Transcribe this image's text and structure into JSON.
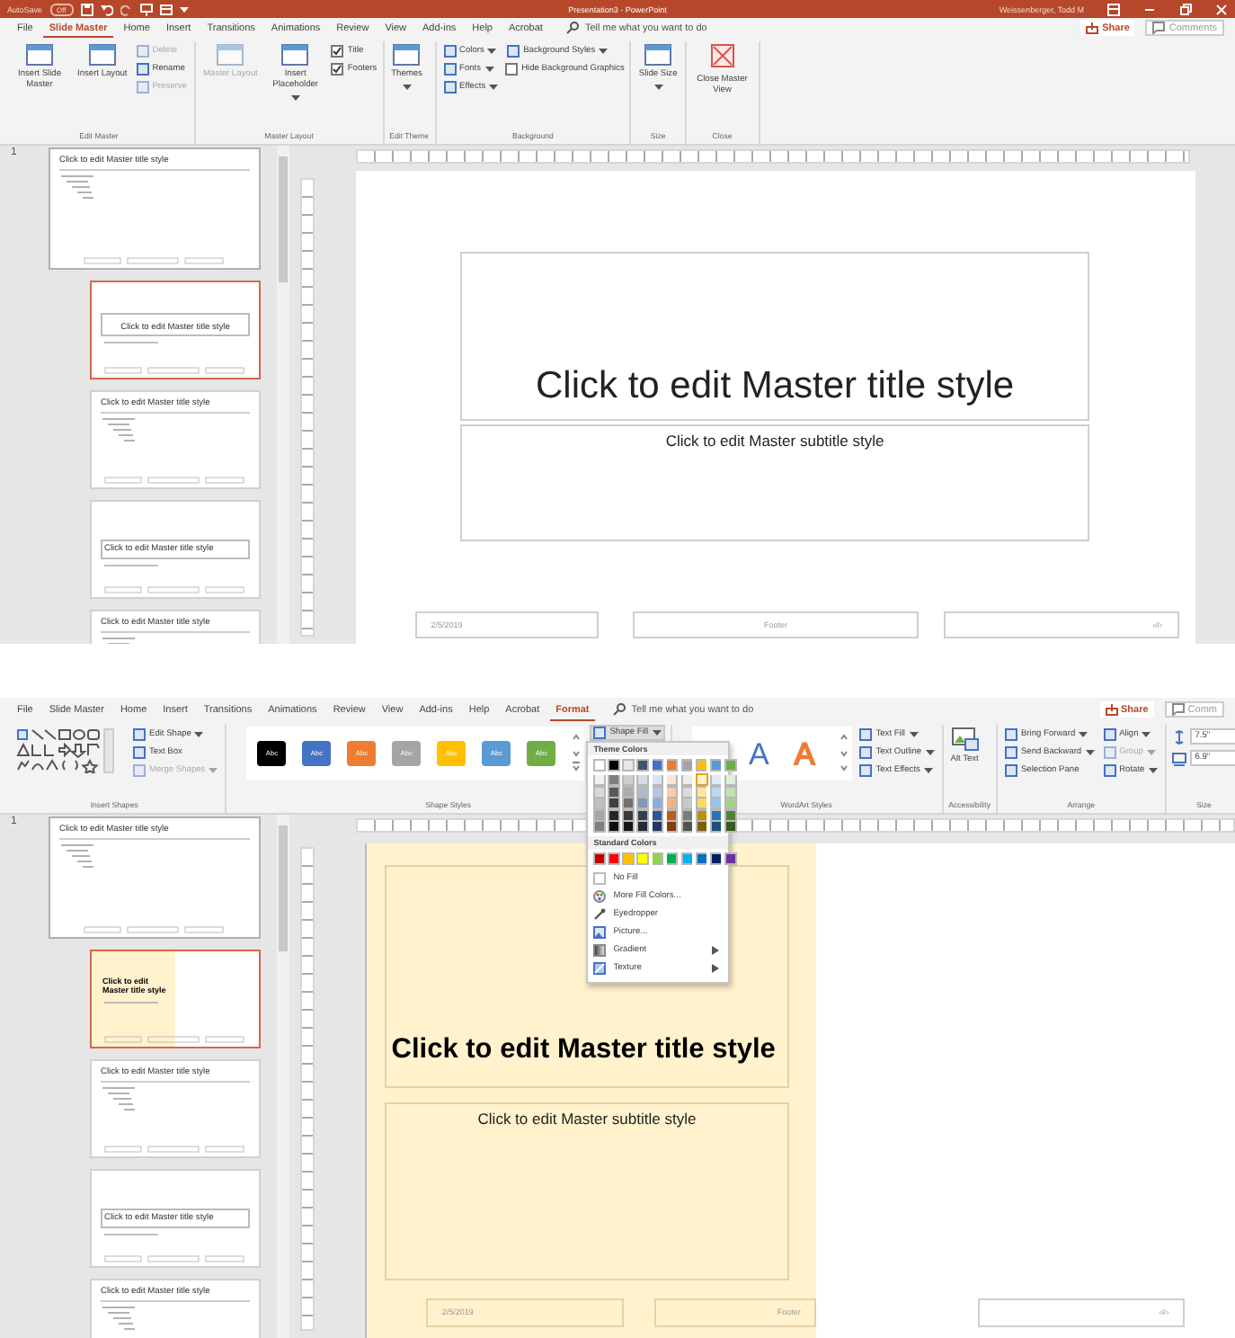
{
  "screens": [
    {
      "title_bar": {
        "autosave": "AutoSave",
        "autosave_state": "Off",
        "title": "Presentation3  -  PowerPoint",
        "user": "Weissenberger, Todd M"
      },
      "tabs": [
        {
          "label": "File",
          "selected": false
        },
        {
          "label": "Slide Master",
          "selected": true
        },
        {
          "label": "Home",
          "selected": false
        },
        {
          "label": "Insert",
          "selected": false
        },
        {
          "label": "Transitions",
          "selected": false
        },
        {
          "label": "Animations",
          "selected": false
        },
        {
          "label": "Review",
          "selected": false
        },
        {
          "label": "View",
          "selected": false
        },
        {
          "label": "Add-ins",
          "selected": false
        },
        {
          "label": "Help",
          "selected": false
        },
        {
          "label": "Acrobat",
          "selected": false
        }
      ],
      "tell_me": "Tell me what you want to do",
      "share": "Share",
      "comments": "Comments",
      "ribbon": [
        {
          "label": "Edit Master",
          "columns": [
            [
              {
                "kind": "large",
                "label": "Insert Slide Master",
                "dropdown": false,
                "disabled": false
              }
            ],
            [
              {
                "kind": "large",
                "label": "Insert Layout",
                "dropdown": false,
                "disabled": false
              }
            ],
            [
              {
                "kind": "small",
                "label": "Delete",
                "dropdown": false,
                "disabled": true
              },
              {
                "kind": "small",
                "label": "Rename",
                "dropdown": false,
                "disabled": false
              },
              {
                "kind": "small",
                "label": "Preserve",
                "dropdown": false,
                "disabled": true
              }
            ]
          ]
        },
        {
          "label": "Master Layout",
          "columns": [
            [
              {
                "kind": "large",
                "label": "Master Layout",
                "dropdown": false,
                "disabled": true
              }
            ],
            [
              {
                "kind": "large",
                "label": "Insert Placeholder",
                "dropdown": true,
                "disabled": false
              }
            ],
            [
              {
                "kind": "check",
                "label": "Title",
                "checked": true
              },
              {
                "kind": "check",
                "label": "Footers",
                "checked": true
              }
            ]
          ]
        },
        {
          "label": "Edit Theme",
          "columns": [
            [
              {
                "kind": "large",
                "label": "Themes",
                "dropdown": true,
                "disabled": false
              }
            ]
          ]
        },
        {
          "label": "Background",
          "columns": [
            [
              {
                "kind": "small",
                "label": "Colors",
                "dropdown": true,
                "disabled": false
              },
              {
                "kind": "small",
                "label": "Fonts",
                "dropdown": true,
                "disabled": false
              },
              {
                "kind": "small",
                "label": "Effects",
                "dropdown": true,
                "disabled": false
              }
            ],
            [
              {
                "kind": "small",
                "label": "Background Styles",
                "dropdown": true,
                "disabled": false
              },
              {
                "kind": "check",
                "label": "Hide Background Graphics",
                "checked": false
              }
            ]
          ]
        },
        {
          "label": "Size",
          "columns": [
            [
              {
                "kind": "large",
                "label": "Slide Size",
                "dropdown": true,
                "disabled": false
              }
            ]
          ]
        },
        {
          "label": "Close",
          "columns": [
            [
              {
                "kind": "large",
                "label": "Close Master View",
                "dropdown": false,
                "disabled": false
              }
            ]
          ]
        }
      ],
      "thumbnails": [
        {
          "number": "1",
          "kind": "master",
          "title": "Click to edit Master title style",
          "selected": false,
          "filled": false
        },
        {
          "kind": "title",
          "title": "Click to edit Master title style",
          "selected": true,
          "filled": false
        },
        {
          "kind": "content",
          "title": "Click to edit Master title style",
          "selected": false,
          "filled": false
        },
        {
          "kind": "section",
          "title": "Click to edit Master title style",
          "selected": false,
          "filled": false
        },
        {
          "kind": "content",
          "title": "Click to edit Master title style",
          "selected": false,
          "filled": false
        }
      ],
      "slide": {
        "filled": false,
        "title": "Click to edit Master title style",
        "subtitle": "Click to edit Master subtitle style",
        "date": "2/5/2019",
        "footer": "Footer",
        "number": "‹#›"
      }
    },
    {
      "tabs": [
        {
          "label": "File",
          "selected": false
        },
        {
          "label": "Slide Master",
          "selected": false
        },
        {
          "label": "Home",
          "selected": false
        },
        {
          "label": "Insert",
          "selected": false
        },
        {
          "label": "Transitions",
          "selected": false
        },
        {
          "label": "Animations",
          "selected": false
        },
        {
          "label": "Review",
          "selected": false
        },
        {
          "label": "View",
          "selected": false
        },
        {
          "label": "Add-ins",
          "selected": false
        },
        {
          "label": "Help",
          "selected": false
        },
        {
          "label": "Acrobat",
          "selected": false
        },
        {
          "label": "Format",
          "selected": true
        }
      ],
      "tell_me": "Tell me what you want to do",
      "share": "Share",
      "comments": "Comm",
      "ribbon": [
        {
          "label": "Insert Shapes",
          "columns": [
            [
              {
                "kind": "shapes"
              }
            ],
            [
              {
                "kind": "small",
                "label": "Edit Shape",
                "dropdown": true,
                "disabled": false
              },
              {
                "kind": "small",
                "label": "Text Box",
                "dropdown": false,
                "disabled": false
              },
              {
                "kind": "small",
                "label": "Merge Shapes",
                "dropdown": true,
                "disabled": true
              }
            ]
          ]
        },
        {
          "label": "Shape Styles",
          "columns": [
            [
              {
                "kind": "styles",
                "swatches": [
                  {
                    "label": "Abc",
                    "color": "#000000"
                  },
                  {
                    "label": "Abc",
                    "color": "#4472c4"
                  },
                  {
                    "label": "Abc",
                    "color": "#ed7d31"
                  },
                  {
                    "label": "Abc",
                    "color": "#a5a5a5"
                  },
                  {
                    "label": "Abc",
                    "color": "#ffc000"
                  },
                  {
                    "label": "Abc",
                    "color": "#5b9bd5"
                  },
                  {
                    "label": "Abc",
                    "color": "#70ad47"
                  }
                ]
              }
            ],
            [
              {
                "kind": "small",
                "label": "Shape Fill",
                "dropdown": true,
                "disabled": false
              }
            ]
          ]
        },
        {
          "label": "WordArt Styles",
          "columns": [
            [
              {
                "kind": "wordart",
                "letters": [
                  {
                    "label": "A",
                    "kind": "fill",
                    "color": "#4472c4"
                  },
                  {
                    "label": "A",
                    "kind": "outline",
                    "color": "#ed7d31"
                  }
                ]
              }
            ],
            [
              {
                "kind": "small",
                "label": "Text Fill",
                "dropdown": true,
                "disabled": false
              },
              {
                "kind": "small",
                "label": "Text Outline",
                "dropdown": true,
                "disabled": false
              },
              {
                "kind": "small",
                "label": "Text Effects",
                "dropdown": true,
                "disabled": false
              }
            ]
          ]
        },
        {
          "label": "Accessibility",
          "columns": [
            [
              {
                "kind": "large",
                "label": "Alt Text",
                "dropdown": false,
                "disabled": false
              }
            ]
          ]
        },
        {
          "label": "Arrange",
          "columns": [
            [
              {
                "kind": "small",
                "label": "Bring Forward",
                "dropdown": true,
                "disabled": false
              },
              {
                "kind": "small",
                "label": "Send Backward",
                "dropdown": true,
                "disabled": false
              },
              {
                "kind": "small",
                "label": "Selection Pane",
                "dropdown": false,
                "disabled": false
              }
            ],
            [
              {
                "kind": "small",
                "label": "Align",
                "dropdown": true,
                "disabled": false
              },
              {
                "kind": "small",
                "label": "Group",
                "dropdown": true,
                "disabled": true
              },
              {
                "kind": "small",
                "label": "Rotate",
                "dropdown": true,
                "disabled": false
              }
            ]
          ]
        },
        {
          "label": "Size",
          "columns": [
            [
              {
                "kind": "spin",
                "value": "7.5\""
              },
              {
                "kind": "spin",
                "value": "6.9\""
              }
            ]
          ]
        }
      ],
      "shape_fill_menu": {
        "theme_heading": "Theme Colors",
        "theme_colors": [
          {
            "color": "#ffffff",
            "selected": false,
            "shades": [
              {
                "color": "#f2f2f2",
                "selected": false
              },
              {
                "color": "#d9d9d9",
                "selected": false
              },
              {
                "color": "#bfbfbf",
                "selected": false
              },
              {
                "color": "#a6a6a6",
                "selected": false
              },
              {
                "color": "#7f7f7f",
                "selected": false
              }
            ]
          },
          {
            "color": "#000000",
            "selected": false,
            "shades": [
              {
                "color": "#7f7f7f",
                "selected": false
              },
              {
                "color": "#595959",
                "selected": false
              },
              {
                "color": "#3f3f3f",
                "selected": false
              },
              {
                "color": "#262626",
                "selected": false
              },
              {
                "color": "#0d0d0d",
                "selected": false
              }
            ]
          },
          {
            "color": "#e7e6e6",
            "selected": false,
            "shades": [
              {
                "color": "#d0cece",
                "selected": false
              },
              {
                "color": "#aeabab",
                "selected": false
              },
              {
                "color": "#757070",
                "selected": false
              },
              {
                "color": "#3a3838",
                "selected": false
              },
              {
                "color": "#171616",
                "selected": false
              }
            ]
          },
          {
            "color": "#44546a",
            "selected": false,
            "shades": [
              {
                "color": "#d6dce4",
                "selected": false
              },
              {
                "color": "#adb9ca",
                "selected": false
              },
              {
                "color": "#8496b0",
                "selected": false
              },
              {
                "color": "#333f4f",
                "selected": false
              },
              {
                "color": "#222a35",
                "selected": false
              }
            ]
          },
          {
            "color": "#4472c4",
            "selected": false,
            "shades": [
              {
                "color": "#dae3f3",
                "selected": false
              },
              {
                "color": "#b4c7e7",
                "selected": false
              },
              {
                "color": "#8faadc",
                "selected": false
              },
              {
                "color": "#2f5597",
                "selected": false
              },
              {
                "color": "#203864",
                "selected": false
              }
            ]
          },
          {
            "color": "#ed7d31",
            "selected": false,
            "shades": [
              {
                "color": "#fbe5d6",
                "selected": false
              },
              {
                "color": "#f8cbad",
                "selected": false
              },
              {
                "color": "#f4b183",
                "selected": false
              },
              {
                "color": "#c55a11",
                "selected": false
              },
              {
                "color": "#843c0c",
                "selected": false
              }
            ]
          },
          {
            "color": "#a5a5a5",
            "selected": false,
            "shades": [
              {
                "color": "#ededed",
                "selected": false
              },
              {
                "color": "#dbdbdb",
                "selected": false
              },
              {
                "color": "#c9c9c9",
                "selected": false
              },
              {
                "color": "#7b7b7b",
                "selected": false
              },
              {
                "color": "#525252",
                "selected": false
              }
            ]
          },
          {
            "color": "#ffc000",
            "selected": false,
            "shades": [
              {
                "color": "#fff2cc",
                "selected": true
              },
              {
                "color": "#ffe699",
                "selected": false
              },
              {
                "color": "#ffd966",
                "selected": false
              },
              {
                "color": "#bf9000",
                "selected": false
              },
              {
                "color": "#7f6000",
                "selected": false
              }
            ]
          },
          {
            "color": "#5b9bd5",
            "selected": false,
            "shades": [
              {
                "color": "#deebf7",
                "selected": false
              },
              {
                "color": "#bdd7ee",
                "selected": false
              },
              {
                "color": "#9dc3e6",
                "selected": false
              },
              {
                "color": "#2e75b6",
                "selected": false
              },
              {
                "color": "#1f4e79",
                "selected": false
              }
            ]
          },
          {
            "color": "#70ad47",
            "selected": false,
            "shades": [
              {
                "color": "#e2f0d9",
                "selected": false
              },
              {
                "color": "#c5e0b4",
                "selected": false
              },
              {
                "color": "#a9d18e",
                "selected": false
              },
              {
                "color": "#548235",
                "selected": false
              },
              {
                "color": "#385723",
                "selected": false
              }
            ]
          }
        ],
        "standard_heading": "Standard Colors",
        "standard_colors": [
          {
            "color": "#c00000",
            "selected": false
          },
          {
            "color": "#ff0000",
            "selected": false
          },
          {
            "color": "#ffc000",
            "selected": false
          },
          {
            "color": "#ffff00",
            "selected": false
          },
          {
            "color": "#92d050",
            "selected": false
          },
          {
            "color": "#00b050",
            "selected": false
          },
          {
            "color": "#00b0f0",
            "selected": false
          },
          {
            "color": "#0070c0",
            "selected": false
          },
          {
            "color": "#002060",
            "selected": false
          },
          {
            "color": "#7030a0",
            "selected": false
          }
        ],
        "items": [
          {
            "kind": "nofill",
            "label": "No Fill",
            "submenu": false
          },
          {
            "kind": "palette",
            "label": "More Fill Colors...",
            "submenu": false
          },
          {
            "kind": "eyedropper",
            "label": "Eyedropper",
            "submenu": false
          },
          {
            "kind": "picture",
            "label": "Picture...",
            "submenu": false
          },
          {
            "kind": "gradient",
            "label": "Gradient",
            "submenu": true
          },
          {
            "kind": "texture",
            "label": "Texture",
            "submenu": true
          }
        ]
      },
      "thumbnails": [
        {
          "kind": "master",
          "number": "1",
          "title": "Click to edit Master title style",
          "selected": false,
          "filled": false
        },
        {
          "kind": "title",
          "title": "Click to edit Master title style",
          "selected": true,
          "filled": true
        },
        {
          "kind": "content",
          "title": "Click to edit Master title style",
          "selected": false,
          "filled": false
        },
        {
          "kind": "section",
          "title": "Click to edit Master title style",
          "selected": false,
          "filled": false
        },
        {
          "kind": "content",
          "title": "Click to edit Master title style",
          "selected": false,
          "filled": false
        }
      ],
      "slide": {
        "filled": true,
        "title": "Click to edit Master title style",
        "subtitle": "Click to edit Master subtitle style",
        "date": "2/5/2019",
        "footer": "Footer",
        "number": "‹#›"
      }
    }
  ]
}
